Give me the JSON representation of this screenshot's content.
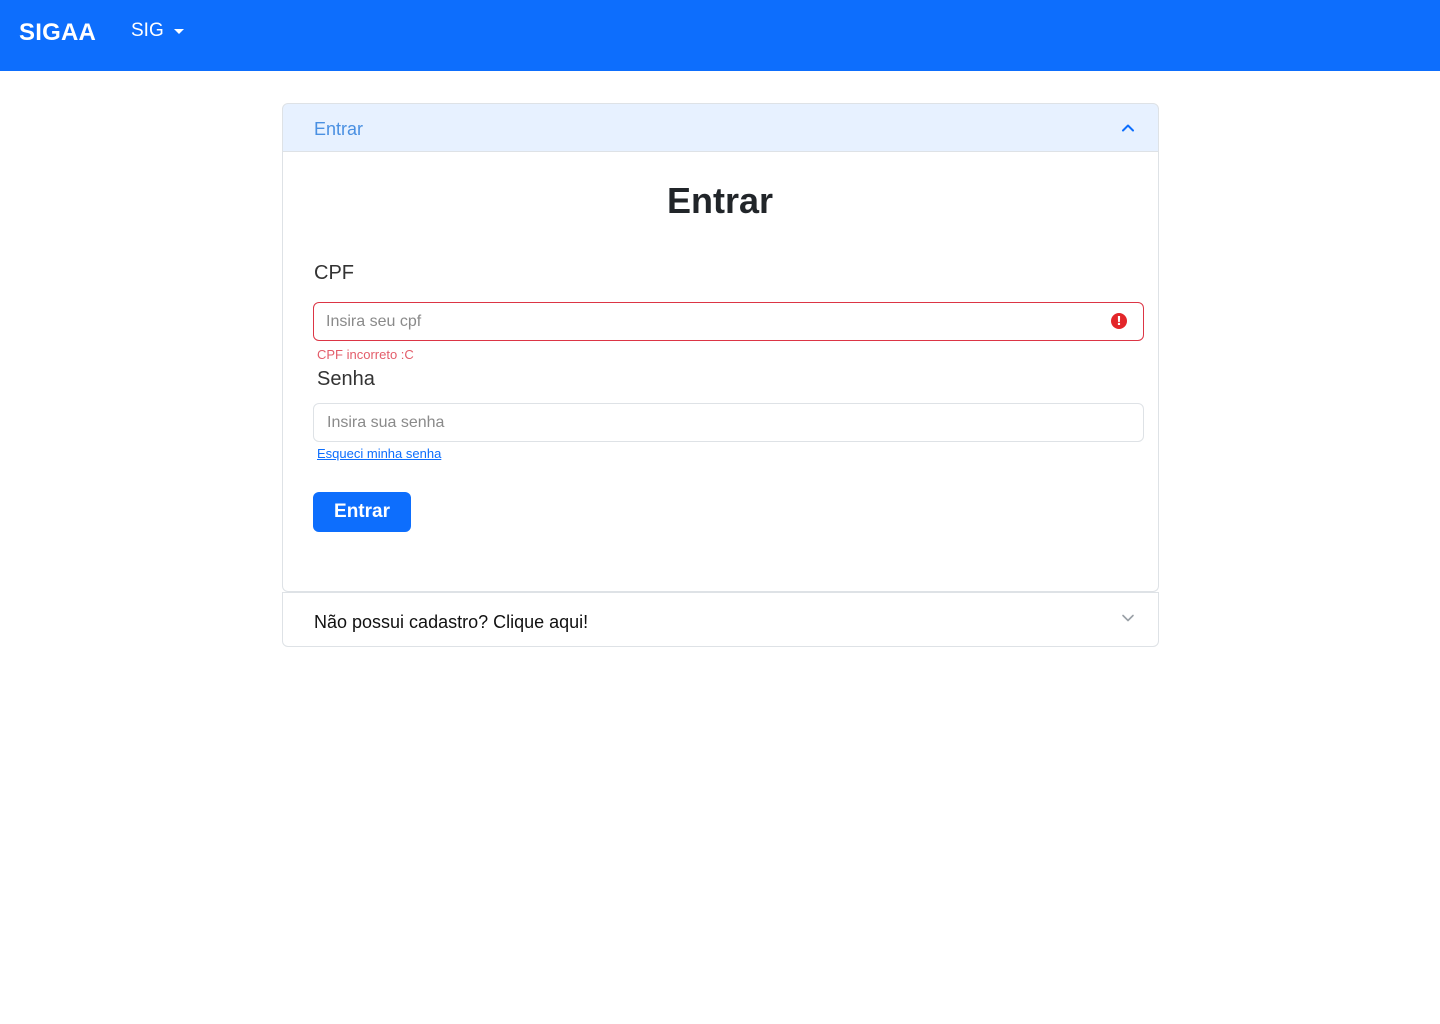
{
  "navbar": {
    "brand": "SIGAA",
    "dropdown_label": "SIG"
  },
  "accordion": {
    "login_header": "Entrar",
    "register_header": "Não possui cadastro? Clique aqui!"
  },
  "login_form": {
    "title": "Entrar",
    "cpf_label": "CPF",
    "cpf_placeholder": "Insira seu cpf",
    "cpf_value": "",
    "cpf_error": "CPF incorreto :C",
    "password_label": "Senha",
    "password_placeholder": "Insira sua senha",
    "password_value": "",
    "forgot_link": "Esqueci minha senha",
    "submit_label": "Entrar"
  },
  "icons": {
    "navbar_caret": "caret-down-icon",
    "login_toggle": "chevron-up-icon",
    "cpf_error": "exclamation-circle-icon",
    "register_toggle": "chevron-down-icon"
  },
  "colors": {
    "primary": "#0d6efd",
    "error": "#dc3545",
    "accordion_active_bg": "#e7f1ff"
  }
}
